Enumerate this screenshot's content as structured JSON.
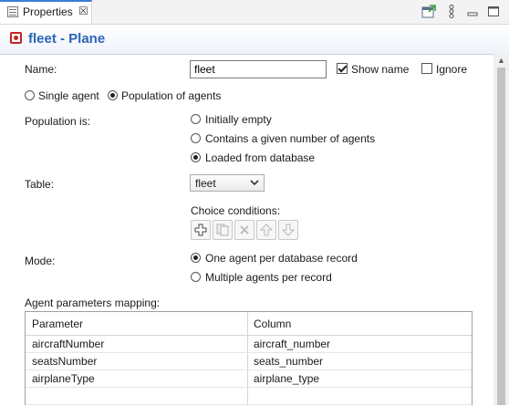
{
  "tab": {
    "label": "Properties",
    "close": "☒"
  },
  "toolbar": {
    "icons": [
      "new-view-icon",
      "more-vert-icon",
      "minimize-icon",
      "maximize-icon"
    ]
  },
  "header": {
    "title": "fleet - Plane"
  },
  "form": {
    "name_label": "Name:",
    "name_value": "fleet",
    "show_name_label": "Show name",
    "show_name_checked": true,
    "ignore_label": "Ignore",
    "ignore_checked": false,
    "agent_options": [
      {
        "label": "Single agent",
        "selected": false
      },
      {
        "label": "Population of agents",
        "selected": true
      }
    ],
    "population_label": "Population is:",
    "population_options": [
      {
        "label": "Initially empty",
        "selected": false
      },
      {
        "label": "Contains a given number of agents",
        "selected": false
      },
      {
        "label": "Loaded from database",
        "selected": true
      }
    ],
    "table_label": "Table:",
    "table_value": "fleet",
    "choice_conditions_label": "Choice conditions:",
    "choice_buttons": [
      "add-icon",
      "copy-icon",
      "delete-icon",
      "move-up-icon",
      "move-down-icon"
    ],
    "mode_label": "Mode:",
    "mode_options": [
      {
        "label": "One agent per database record",
        "selected": true
      },
      {
        "label": "Multiple agents per record",
        "selected": false
      }
    ],
    "mapping_label": "Agent parameters mapping:"
  },
  "mapping_table": {
    "headers": [
      "Parameter",
      "Column"
    ],
    "rows": [
      [
        "aircraftNumber",
        "aircraft_number"
      ],
      [
        "seatsNumber",
        "seats_number"
      ],
      [
        "airplaneType",
        "airplane_type"
      ]
    ]
  },
  "colors": {
    "accent": "#2a64b8",
    "object_icon": "#c62424",
    "tab_active": "#3b7dd8"
  }
}
